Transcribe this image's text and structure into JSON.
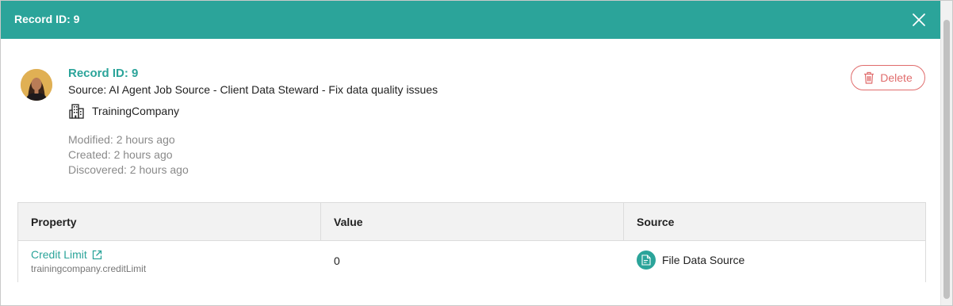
{
  "header": {
    "title": "Record ID: 9"
  },
  "record": {
    "title": "Record ID: 9",
    "source": "Source: AI Agent Job Source - Client Data Steward - Fix data quality issues",
    "company": "TrainingCompany",
    "modified": "Modified: 2 hours ago",
    "created": "Created: 2 hours ago",
    "discovered": "Discovered: 2 hours ago"
  },
  "actions": {
    "delete_label": "Delete"
  },
  "table": {
    "columns": [
      "Property",
      "Value",
      "Source"
    ],
    "rows": [
      {
        "property": "Credit Limit",
        "key": "trainingcompany.creditLimit",
        "value": "0",
        "source": "File Data Source"
      }
    ]
  },
  "colors": {
    "accent": "#2ba49a",
    "danger": "#e06c6c"
  },
  "icons": {
    "close": "close-icon",
    "company": "building-icon",
    "delete": "trash-icon",
    "external": "external-link-icon",
    "source": "file-data-source-icon"
  }
}
